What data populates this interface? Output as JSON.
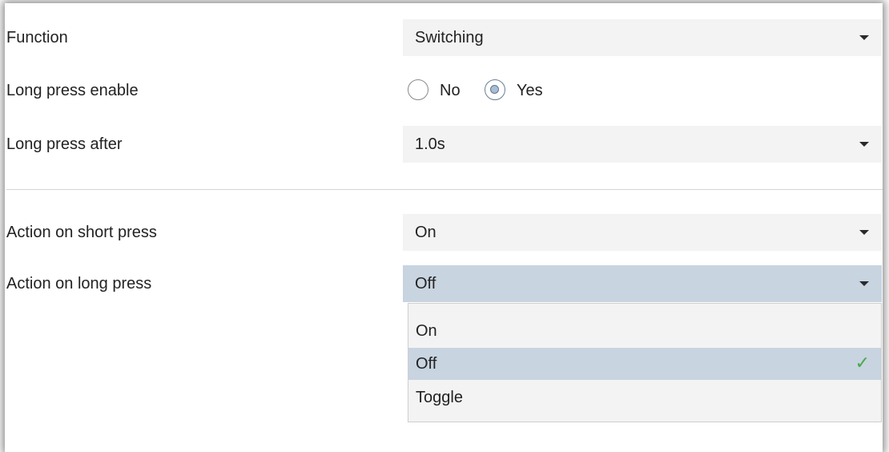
{
  "rows": {
    "function": {
      "label": "Function",
      "value": "Switching"
    },
    "long_press_enable": {
      "label": "Long press enable",
      "options": [
        {
          "label": "No",
          "checked": false
        },
        {
          "label": "Yes",
          "checked": true
        }
      ]
    },
    "long_press_after": {
      "label": "Long press after",
      "value": "1.0s"
    },
    "short_press_action": {
      "label": "Action on short press",
      "value": "On"
    },
    "long_press_action": {
      "label": "Action on long press",
      "value": "Off",
      "open": true
    }
  },
  "dropdown": {
    "options": [
      {
        "label": "On",
        "selected": false
      },
      {
        "label": "Off",
        "selected": true
      },
      {
        "label": "Toggle",
        "selected": false
      }
    ],
    "check_glyph": "✓"
  },
  "icons": {
    "caret": "chevron-down-icon",
    "check": "checkmark-icon"
  },
  "colors": {
    "field_bg": "#f3f3f3",
    "active_bg": "#c8d4e0",
    "check": "#47a84a",
    "radio_fill": "#a9bdd3"
  }
}
